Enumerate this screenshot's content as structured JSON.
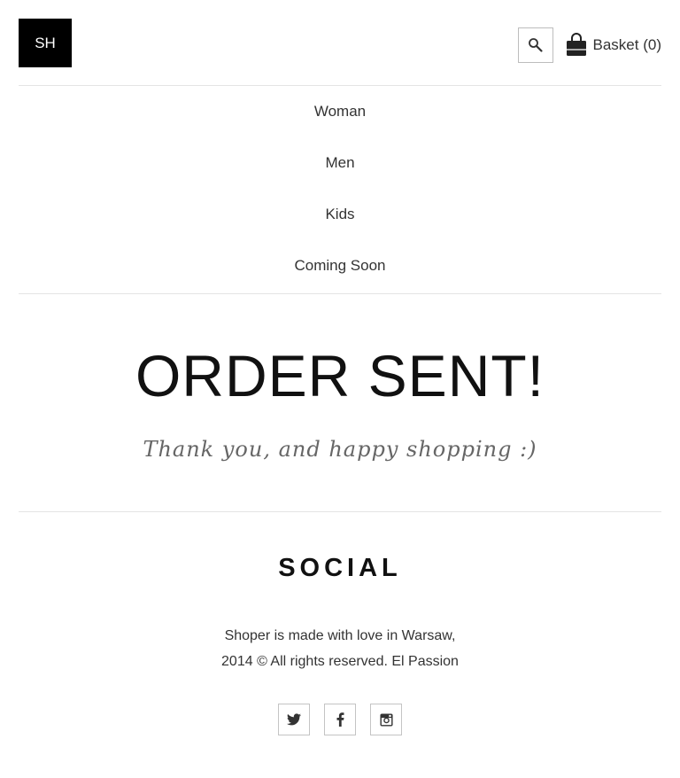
{
  "header": {
    "logo_text": "SH",
    "basket_label": "Basket (0)"
  },
  "nav": {
    "items": [
      {
        "label": "Woman"
      },
      {
        "label": "Men"
      },
      {
        "label": "Kids"
      },
      {
        "label": "Coming Soon"
      }
    ]
  },
  "main": {
    "headline": "ORDER SENT!",
    "subline": "Thank you, and happy shopping :)"
  },
  "footer": {
    "social_title": "SOCIAL",
    "copyright_line1": "Shoper is made with love in Warsaw,",
    "copyright_line2": "2014 © All rights reserved. El Passion",
    "social_icons": [
      "twitter-icon",
      "facebook-icon",
      "instagram-icon"
    ]
  },
  "colors": {
    "logo_bg": "#000000",
    "text": "#333333",
    "subline": "#666666",
    "divider": "#e4e4e4"
  }
}
